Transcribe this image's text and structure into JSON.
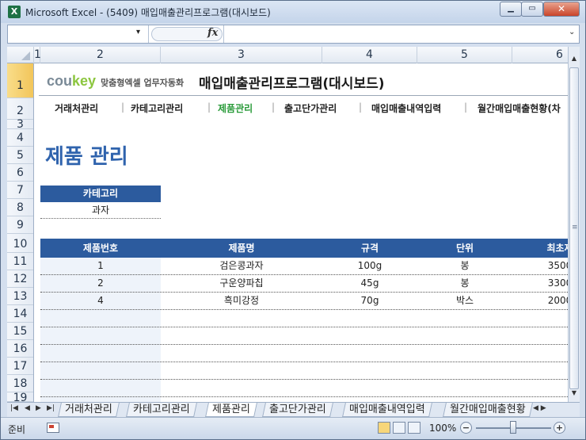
{
  "window": {
    "title": "Microsoft Excel - (5409) 매입매출관리프로그램(대시보드)",
    "min_label": "▁",
    "max_label": "▭",
    "close_label": "✕",
    "icon_text": "X"
  },
  "formula_bar": {
    "fx_label": "fx",
    "namebox_arrow": "▾",
    "expand_arrow": "⌄"
  },
  "columns": [
    "1",
    "2",
    "3",
    "4",
    "5",
    "6"
  ],
  "rows": [
    "1",
    "2",
    "3",
    "4",
    "5",
    "6",
    "7",
    "8",
    "9",
    "10",
    "11",
    "12",
    "13",
    "14",
    "15",
    "16",
    "17",
    "18",
    "19"
  ],
  "brand": {
    "cou": "cou",
    "key": "key",
    "subtitle": "맞춤형엑셀 업무자동화"
  },
  "app_title": "매입매출관리프로그램(대시보드)",
  "nav": [
    {
      "label": "거래처관리"
    },
    {
      "label": "카테고리관리"
    },
    {
      "label": "제품관리",
      "active": true
    },
    {
      "label": "출고단가관리"
    },
    {
      "label": "매입매출내역입력"
    },
    {
      "label": "월간매입매출현황(차"
    }
  ],
  "nav_sep": "|",
  "page_title": "제품 관리",
  "category": {
    "header": "카테고리",
    "value": "과자"
  },
  "table": {
    "headers": [
      "제품번호",
      "제품명",
      "규격",
      "단위",
      "최초재"
    ],
    "rows": [
      [
        "1",
        "검은콩과자",
        "100g",
        "봉",
        "3500"
      ],
      [
        "2",
        "구운양파칩",
        "45g",
        "봉",
        "3300"
      ],
      [
        "4",
        "흑미강정",
        "70g",
        "박스",
        "2000"
      ]
    ]
  },
  "tabs": [
    {
      "label": "거래처관리"
    },
    {
      "label": "카테고리관리"
    },
    {
      "label": "제품관리",
      "active": true
    },
    {
      "label": "출고단가관리"
    },
    {
      "label": "매입매출내역입력"
    },
    {
      "label": "월간매입매출현황"
    }
  ],
  "tab_nav": {
    "first": "|◀",
    "prev": "◀",
    "next": "▶",
    "last": "▶|"
  },
  "status": {
    "ready": "준비",
    "zoom": "100%",
    "zoom_minus": "−",
    "zoom_plus": "+"
  },
  "scroll": {
    "up": "▲",
    "down": "▼",
    "grip": "≡"
  }
}
